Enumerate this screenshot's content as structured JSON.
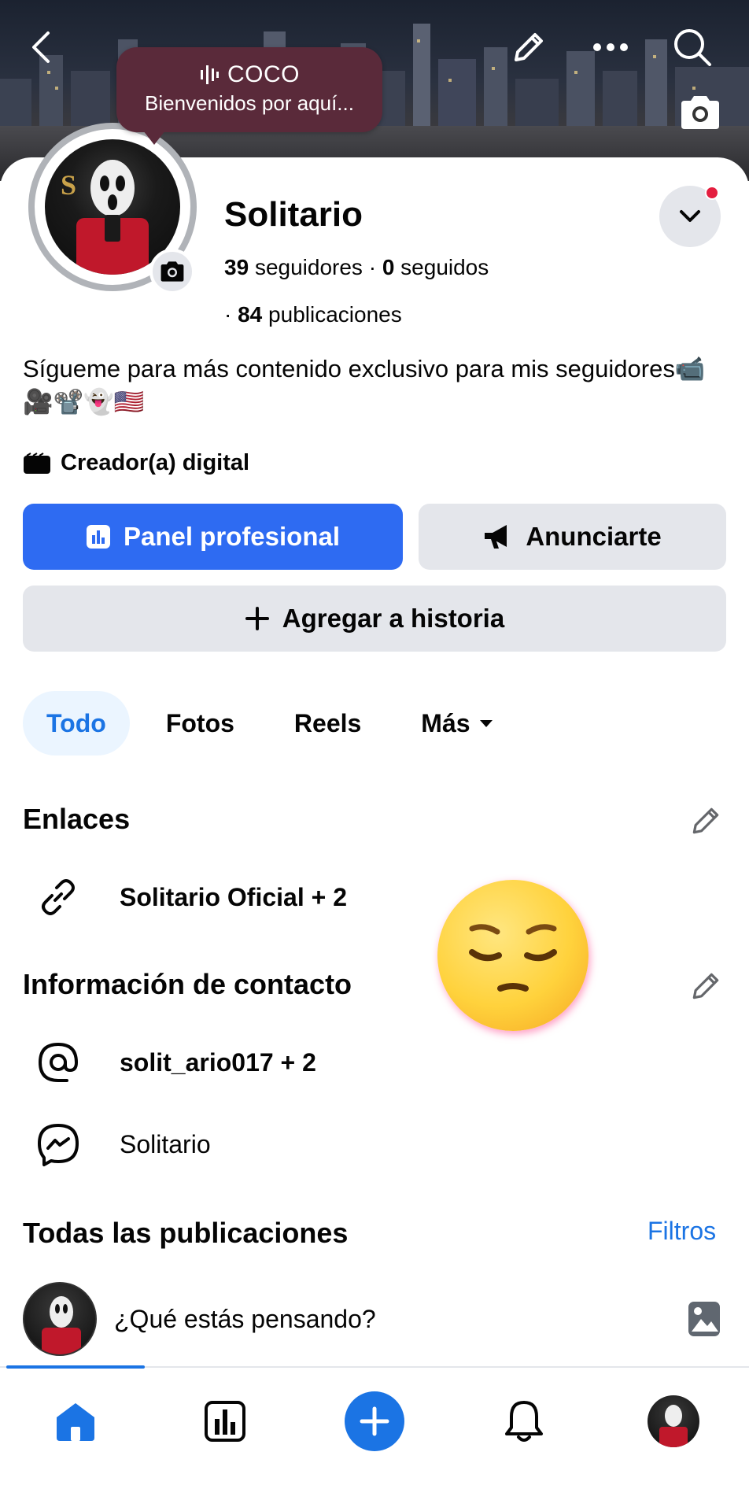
{
  "header": {
    "back_icon": "chevron-left-icon",
    "edit_icon": "pencil-icon",
    "more_icon": "more-horizontal-icon",
    "search_icon": "search-icon",
    "cover_camera_icon": "camera-icon"
  },
  "tooltip": {
    "title": "COCO",
    "subtitle": "Bienvenidos por aquí..."
  },
  "profile": {
    "name": "Solitario",
    "followers_count": "39",
    "followers_label": "seguidores",
    "separator": "·",
    "following_count": "0",
    "following_label": "seguidos",
    "posts_prefix": "·",
    "posts_count": "84",
    "posts_label": "publicaciones",
    "bio": "Sígueme para más contenido exclusivo para mis seguidores📹🎥📽️👻🇺🇸",
    "category": "Creador(a) digital"
  },
  "buttons": {
    "professional_dashboard": "Panel profesional",
    "advertise": "Anunciarte",
    "add_story": "Agregar a historia"
  },
  "tabs": [
    {
      "label": "Todo",
      "active": true
    },
    {
      "label": "Fotos",
      "active": false
    },
    {
      "label": "Reels",
      "active": false
    },
    {
      "label": "Más",
      "active": false
    }
  ],
  "links": {
    "title": "Enlaces",
    "item": "Solitario Oficial + 2"
  },
  "contact": {
    "title": "Información de contacto",
    "instagram": "solit_ario017 + 2",
    "messenger": "Solitario"
  },
  "posts": {
    "title": "Todas las publicaciones",
    "filters": "Filtros",
    "composer_placeholder": "¿Qué estás pensando?"
  },
  "sticker": "pensive-face-emoji",
  "colors": {
    "primary": "#2e6bf2",
    "link": "#1b74e4",
    "button_gray": "#e4e6eb",
    "tooltip": "#5a2a3a",
    "notification_dot": "#e41e3f"
  },
  "bottom_nav": [
    "home-icon",
    "dashboard-icon",
    "create-icon",
    "notifications-icon",
    "profile-avatar"
  ]
}
